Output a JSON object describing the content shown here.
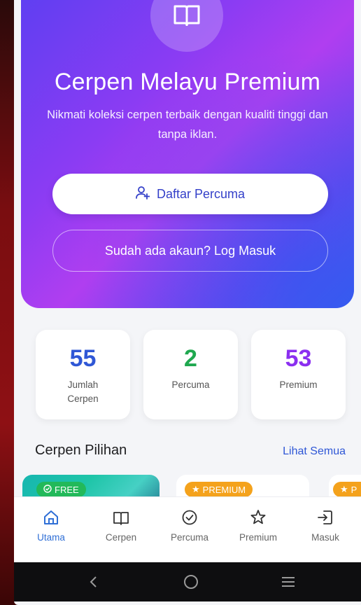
{
  "hero": {
    "icon": "book-open-icon",
    "title": "Cerpen Melayu Premium",
    "subtitle": "Nikmati koleksi cerpen terbaik dengan kualiti tinggi dan tanpa iklan.",
    "register_label": "Daftar Percuma",
    "register_icon": "user-plus-icon",
    "login_label": "Sudah ada akaun? Log Masuk"
  },
  "stats": [
    {
      "value": "55",
      "label": "Jumlah Cerpen",
      "color": "#2f57d6"
    },
    {
      "value": "2",
      "label": "Percuma",
      "color": "#1fa84f"
    },
    {
      "value": "53",
      "label": "Premium",
      "color": "#8b2ff0"
    }
  ],
  "section": {
    "title": "Cerpen Pilihan",
    "link": "Lihat Semua"
  },
  "cards": [
    {
      "badge": "FREE",
      "badge_icon": "check-circle-icon"
    },
    {
      "badge": "PREMIUM",
      "badge_icon": "star-icon"
    },
    {
      "badge": "P",
      "badge_icon": "star-icon"
    }
  ],
  "nav": [
    {
      "label": "Utama",
      "icon": "home-icon",
      "active": true
    },
    {
      "label": "Cerpen",
      "icon": "book-icon",
      "active": false
    },
    {
      "label": "Percuma",
      "icon": "check-circle-icon",
      "active": false
    },
    {
      "label": "Premium",
      "icon": "star-icon",
      "active": false
    },
    {
      "label": "Masuk",
      "icon": "login-icon",
      "active": false
    }
  ],
  "system_nav": [
    "back-icon",
    "home-circle-icon",
    "recents-icon"
  ],
  "colors": {
    "accent": "#2f57d6",
    "free": "#22b95a",
    "premium_badge": "#f4a21c",
    "hero_start": "#5d3ff2",
    "hero_end": "#3d5cf0"
  }
}
